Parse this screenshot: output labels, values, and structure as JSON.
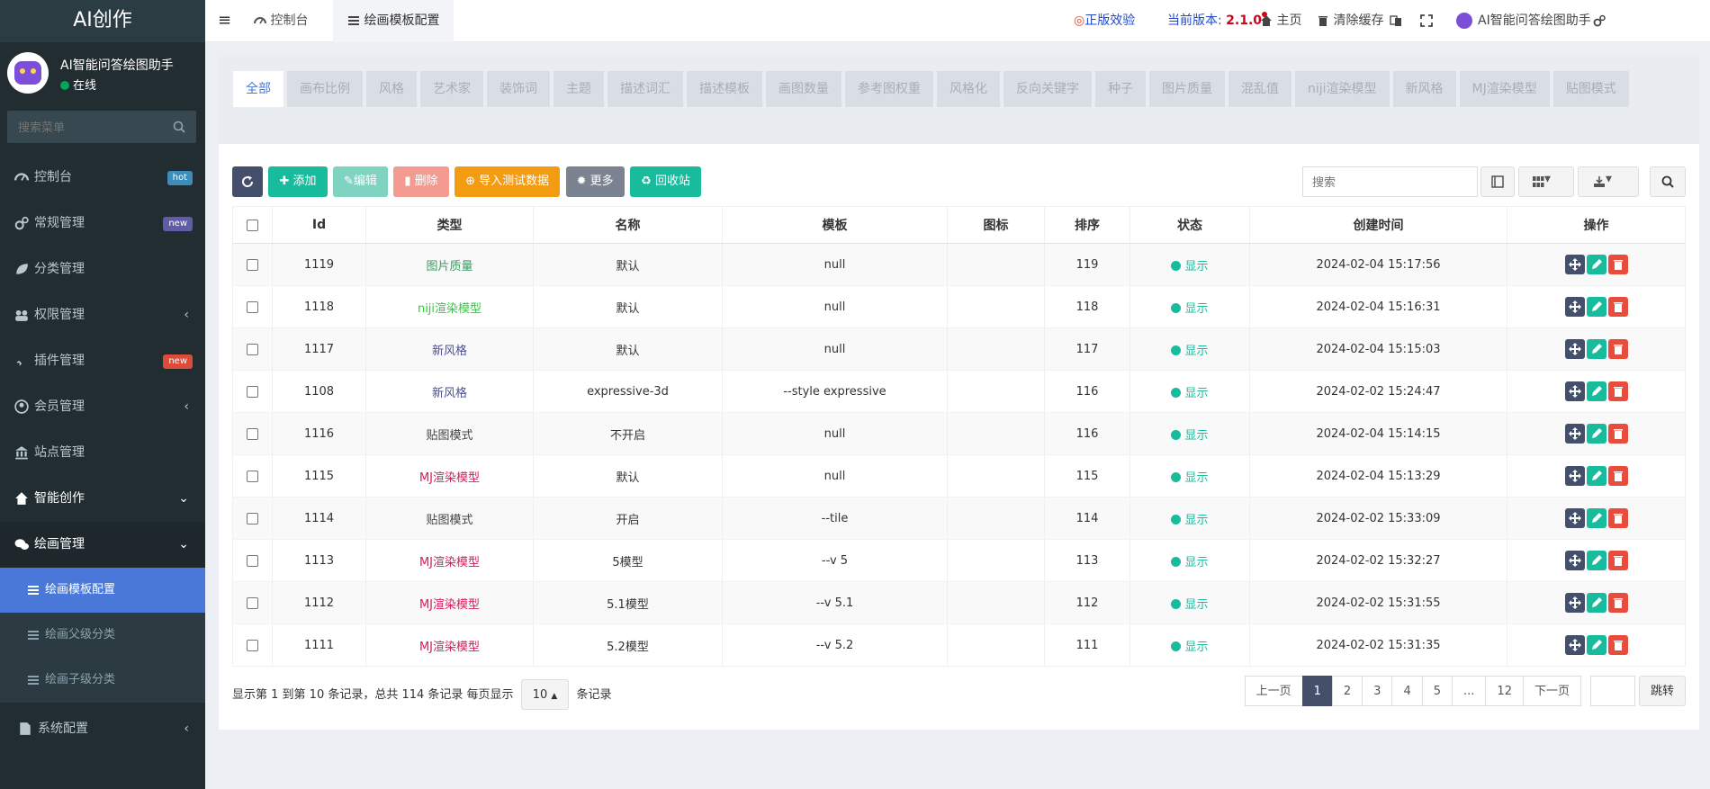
{
  "app": {
    "logo": "AI创作"
  },
  "user": {
    "name": "AI智能问答绘图助手",
    "status": "在线"
  },
  "sidebar": {
    "search_placeholder": "搜索菜单",
    "items": [
      {
        "label": "控制台",
        "badge": "hot",
        "badge_color": "#3c8dbc",
        "icon": "dashboard-icon"
      },
      {
        "label": "常规管理",
        "badge": "new",
        "badge_color": "#605ca8",
        "icon": "cogs-icon"
      },
      {
        "label": "分类管理",
        "icon": "leaf-icon"
      },
      {
        "label": "权限管理",
        "icon": "group-icon"
      },
      {
        "label": "插件管理",
        "badge": "new",
        "badge_color": "#dd4b39",
        "icon": "rocket-icon"
      },
      {
        "label": "会员管理",
        "icon": "user-circle-icon"
      },
      {
        "label": "站点管理",
        "icon": "bank-icon"
      },
      {
        "label": "智能创作",
        "icon": "home-icon"
      },
      {
        "label": "绘画管理",
        "icon": "wechat-icon"
      }
    ],
    "sub_items": [
      "绘画模板配置",
      "绘画父级分类",
      "绘画子级分类"
    ],
    "last_item": "系统配置"
  },
  "topbar": {
    "menu_toggle": "≡",
    "tab_dashboard": "控制台",
    "tab_current": "绘画模板配置",
    "genuine_label": "正版效验",
    "version_label": "当前版本:",
    "version_value": "2.1.0",
    "home_label": "主页",
    "clear_cache_label": "清除缓存",
    "assistant_label": "AI智能问答绘图助手"
  },
  "category_tabs": [
    "全部",
    "画布比例",
    "风格",
    "艺术家",
    "装饰词",
    "主题",
    "描述词汇",
    "描述模板",
    "画图数量",
    "参考图权重",
    "风格化",
    "反向关键字",
    "种子",
    "图片质量",
    "混乱值",
    "niji渲染模型",
    "新风格",
    "MJ渲染模型",
    "贴图模式"
  ],
  "toolbar": {
    "add": "添加",
    "edit": "编辑",
    "delete": "删除",
    "import": "导入测试数据",
    "more": "更多",
    "recycle": "回收站",
    "search_placeholder": "搜索"
  },
  "table": {
    "headers": [
      "Id",
      "类型",
      "名称",
      "模板",
      "图标",
      "排序",
      "状态",
      "创建时间",
      "操作"
    ],
    "rows": [
      {
        "id": "1119",
        "type": "图片质量",
        "type_color": "#3c9a5f",
        "name": "默认",
        "template": "null",
        "icon": "",
        "sort": "119",
        "status": "显示",
        "created": "2024-02-04 15:17:56"
      },
      {
        "id": "1118",
        "type": "niji渲染模型",
        "type_color": "#2ecc40",
        "name": "默认",
        "template": "null",
        "icon": "",
        "sort": "118",
        "status": "显示",
        "created": "2024-02-04 15:16:31"
      },
      {
        "id": "1117",
        "type": "新风格",
        "type_color": "#4a4f9a",
        "name": "默认",
        "template": "null",
        "icon": "",
        "sort": "117",
        "status": "显示",
        "created": "2024-02-04 15:15:03"
      },
      {
        "id": "1108",
        "type": "新风格",
        "type_color": "#4a4f9a",
        "name": "expressive-3d",
        "template": "--style expressive",
        "icon": "",
        "sort": "116",
        "status": "显示",
        "created": "2024-02-02 15:24:47"
      },
      {
        "id": "1116",
        "type": "贴图模式",
        "type_color": "#444444",
        "name": "不开启",
        "template": "null",
        "icon": "",
        "sort": "116",
        "status": "显示",
        "created": "2024-02-04 15:14:15"
      },
      {
        "id": "1115",
        "type": "MJ渲染模型",
        "type_color": "#d81b60",
        "name": "默认",
        "template": "null",
        "icon": "",
        "sort": "115",
        "status": "显示",
        "created": "2024-02-04 15:13:29"
      },
      {
        "id": "1114",
        "type": "贴图模式",
        "type_color": "#444444",
        "name": "开启",
        "template": "--tile",
        "icon": "",
        "sort": "114",
        "status": "显示",
        "created": "2024-02-02 15:33:09"
      },
      {
        "id": "1113",
        "type": "MJ渲染模型",
        "type_color": "#d81b60",
        "name": "5模型",
        "template": "--v 5",
        "icon": "",
        "sort": "113",
        "status": "显示",
        "created": "2024-02-02 15:32:27"
      },
      {
        "id": "1112",
        "type": "MJ渲染模型",
        "type_color": "#d81b60",
        "name": "5.1模型",
        "template": "--v 5.1",
        "icon": "",
        "sort": "112",
        "status": "显示",
        "created": "2024-02-02 15:31:55"
      },
      {
        "id": "1111",
        "type": "MJ渲染模型",
        "type_color": "#d81b60",
        "name": "5.2模型",
        "template": "--v 5.2",
        "icon": "",
        "sort": "111",
        "status": "显示",
        "created": "2024-02-02 15:31:35"
      }
    ]
  },
  "pagination": {
    "info_prefix": "显示第 1 到第 10 条记录，总共 114 条记录 每页显示",
    "page_size": "10",
    "info_suffix": "条记录",
    "prev": "上一页",
    "pages": [
      "1",
      "2",
      "3",
      "4",
      "5",
      "...",
      "12"
    ],
    "current": "1",
    "next": "下一页",
    "jump": "跳转"
  },
  "colors": {
    "sidebar_bg": "#222d32",
    "accent": "#4a78d8",
    "btn_refresh": "#444f6b",
    "btn_add": "#18bc9c",
    "btn_edit": "#7ed3c1",
    "btn_delete": "#f39a91",
    "btn_import": "#f39c12",
    "btn_more": "#7b8290",
    "btn_recycle": "#18bc9c",
    "status": "#18bc9c"
  }
}
